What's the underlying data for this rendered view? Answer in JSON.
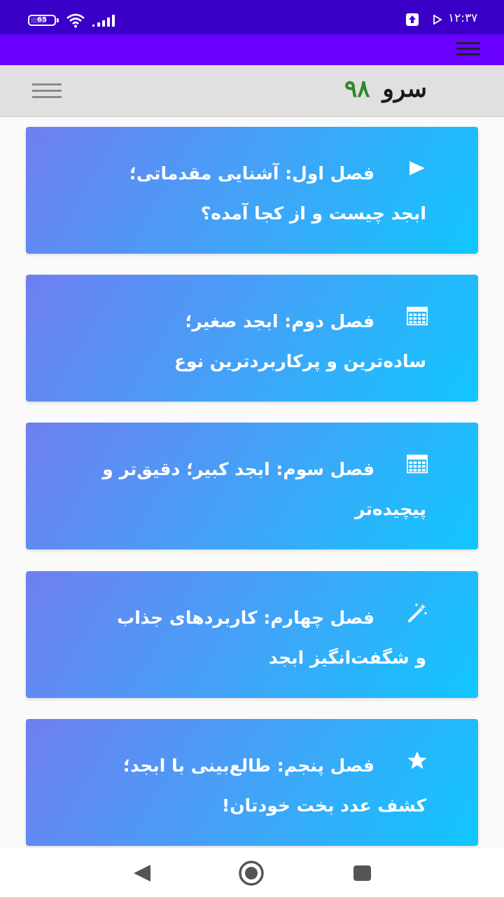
{
  "status_bar": {
    "battery_level": "65",
    "time": "۱۲:۳۷"
  },
  "header": {
    "title_word": "سرو",
    "title_number": "۹۸"
  },
  "chapters": [
    {
      "line1": "فصل اول: آشنایی مقدماتی؛",
      "line2": "ابجد چیست و از کجا آمده؟",
      "icon": "play-icon"
    },
    {
      "line1": "فصل دوم: ابجد صغیر؛",
      "line2": "ساده‌ترین و پرکاربردترین نوع",
      "icon": "calculator-icon"
    },
    {
      "line1": "فصل سوم: ابجد کبیر؛ دقیق‌تر و",
      "line2": "پیچیده‌تر",
      "icon": "calculator-icon"
    },
    {
      "line1": "فصل چهارم: کاربردهای جذاب",
      "line2": "و شگفت‌انگیز ابجد",
      "icon": "magic-wand-icon"
    },
    {
      "line1": "فصل پنجم: طالع‌بینی با ابجد؛",
      "line2": "کشف عدد بخت خودتان!",
      "icon": "star-icon"
    }
  ],
  "colors": {
    "status_bar": "#3a00c8",
    "toolbar": "#6a00ff",
    "header": "#e0e0e0",
    "title_number": "#2a8a2a",
    "card_gradient_start": "#6f7ff0",
    "card_gradient_end": "#11c6fe"
  }
}
